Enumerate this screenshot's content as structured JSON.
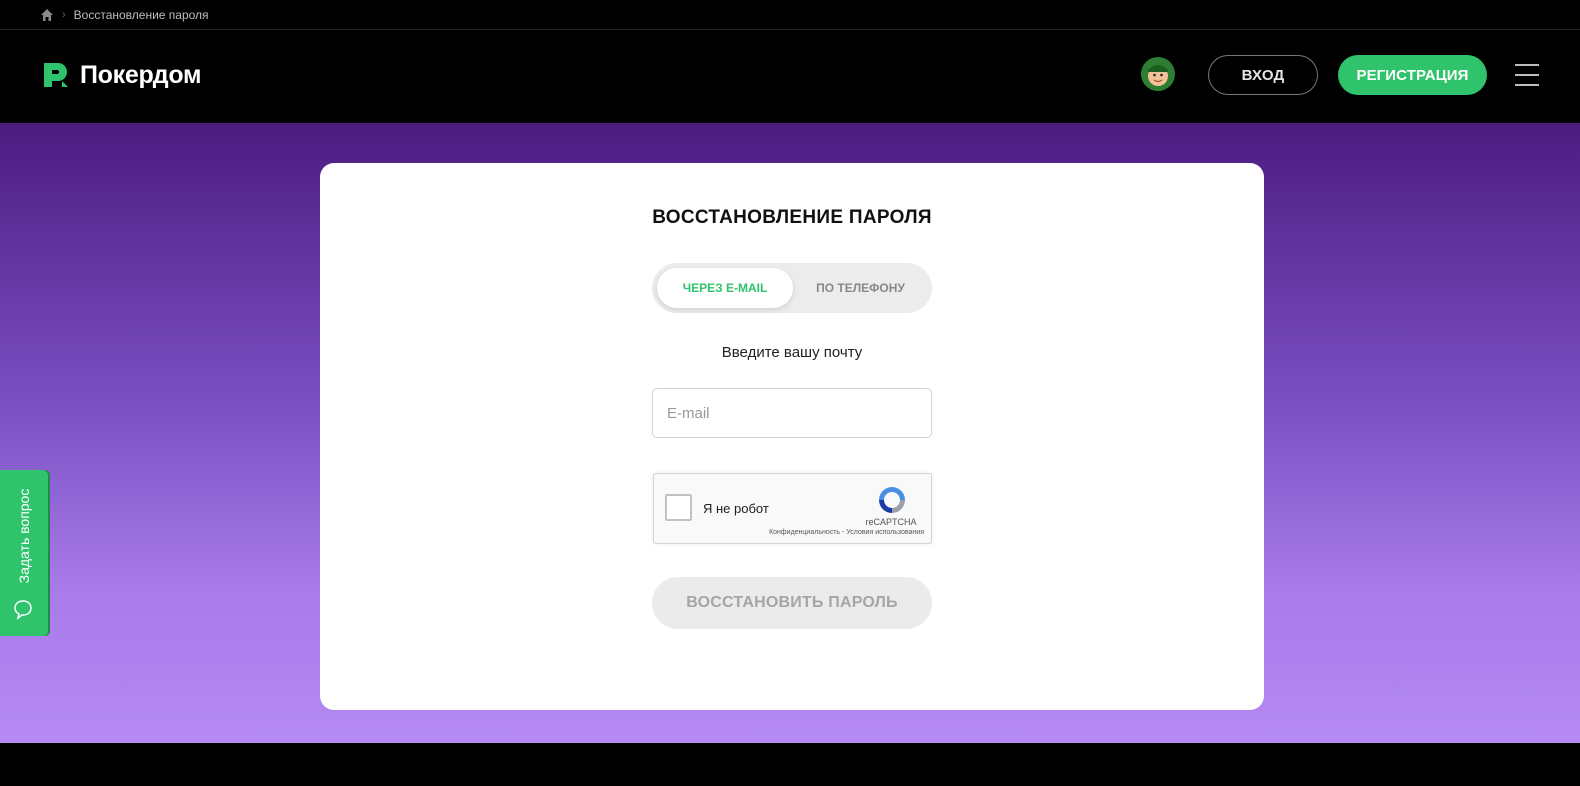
{
  "breadcrumb": {
    "current": "Восстановление пароля"
  },
  "header": {
    "logo_text": "Покердом",
    "login_label": "ВХОД",
    "register_label": "РЕГИСТРАЦИЯ"
  },
  "form": {
    "title": "ВОССТАНОВЛЕНИЕ ПАРОЛЯ",
    "tabs": [
      {
        "label": "ЧЕРЕЗ E-MAIL",
        "active": true
      },
      {
        "label": "ПО ТЕЛЕФОНУ",
        "active": false
      }
    ],
    "subtitle": "Введите вашу почту",
    "email_placeholder": "E-mail",
    "email_value": "",
    "submit_label": "ВОССТАНОВИТЬ ПАРОЛЬ"
  },
  "captcha": {
    "label": "Я не робот",
    "brand": "reCAPTCHA",
    "links": "Конфиденциальность - Условия использования"
  },
  "side_tab": {
    "label": "Задать вопрос"
  },
  "colors": {
    "accent": "#2fc46b",
    "header_bg": "#000000",
    "gradient_top": "#4b1c80",
    "gradient_bottom": "#b58af5"
  }
}
